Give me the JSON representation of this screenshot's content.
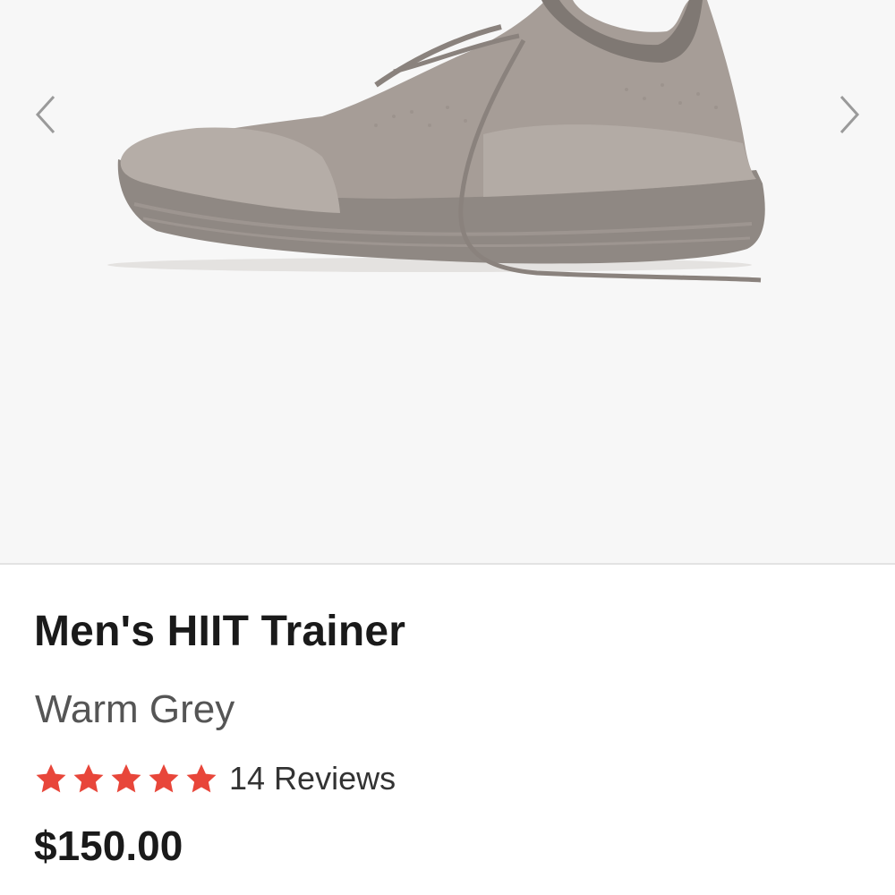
{
  "product": {
    "title": "Men's HIIT Trainer",
    "color": "Warm Grey",
    "rating": 5,
    "rating_max": 5,
    "reviews_label": "14 Reviews",
    "price": "$150.00"
  },
  "gallery": {
    "prev_icon": "chevron-left-icon",
    "next_icon": "chevron-right-icon"
  },
  "colors": {
    "background": "#f7f7f7",
    "star": "#e8463a",
    "shoe_upper": "#a69d97",
    "shoe_sole": "#8f8883"
  }
}
